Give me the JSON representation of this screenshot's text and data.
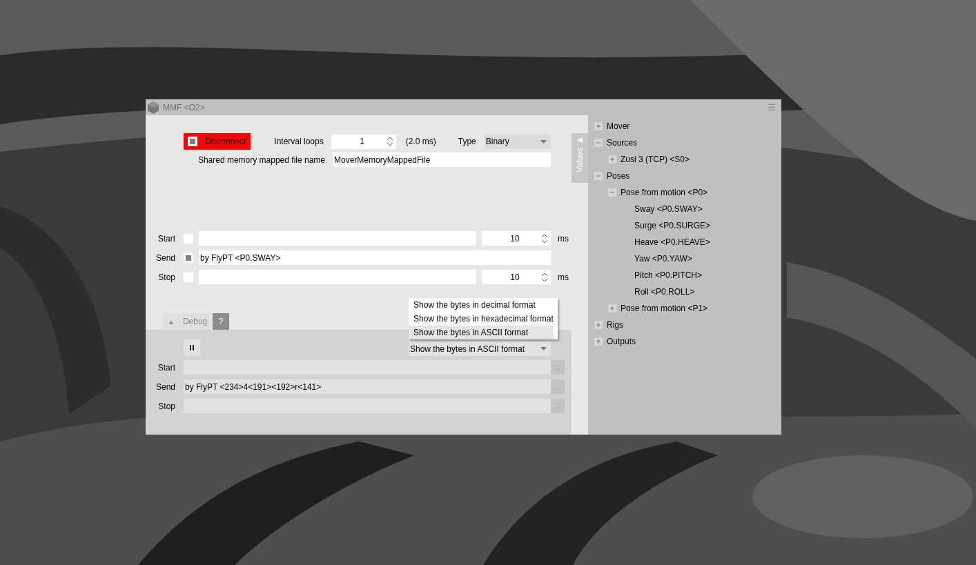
{
  "window": {
    "title": "MMF <O2>",
    "menu": "☰"
  },
  "connection": {
    "button_label": "Disconnect",
    "connected": true
  },
  "interval": {
    "label": "Interval loops",
    "value": "1",
    "note": "(2.0 ms)"
  },
  "type": {
    "label": "Type",
    "value": "Binary"
  },
  "mmf": {
    "label": "Shared memory mapped file name",
    "value": "MoverMemoryMappedFile"
  },
  "values_tab": {
    "label": "Values",
    "arrow": "◀"
  },
  "commands": [
    {
      "label": "Start",
      "checked": false,
      "delay": "10",
      "unit": "ms"
    },
    {
      "label": "Send",
      "checked": true,
      "value": "by FlyPT <P0.SWAY>"
    },
    {
      "label": "Stop",
      "checked": false,
      "delay": "10",
      "unit": "ms"
    }
  ],
  "debug": {
    "arrow": "▲",
    "tab_label": "Debug",
    "help_label": "?",
    "format_value": "Show the bytes in ASCII format",
    "format_menu": [
      {
        "label": "Show the bytes in decimal format",
        "selected": false
      },
      {
        "label": "Show the bytes in hexadecimal format",
        "selected": false
      },
      {
        "label": "Show the bytes in ASCII format",
        "selected": true
      }
    ],
    "rows": [
      {
        "label": "Start",
        "button": "..."
      },
      {
        "label": "Send",
        "value": "by FlyPT <234>4<191><192>r<141>",
        "button": "..."
      },
      {
        "label": "Stop",
        "button": "..."
      }
    ]
  },
  "tree": [
    {
      "label": "Mover",
      "expanded": false
    },
    {
      "label": "Sources",
      "expanded": true,
      "children": [
        {
          "label": "Zusi 3 (TCP) <S0>",
          "expanded": false
        }
      ]
    },
    {
      "label": "Poses",
      "expanded": true,
      "children": [
        {
          "label": "Pose from motion <P0>",
          "expanded": true,
          "children": [
            {
              "label": "Sway <P0.SWAY>"
            },
            {
              "label": "Surge <P0.SURGE>"
            },
            {
              "label": "Heave <P0.HEAVE>"
            },
            {
              "label": "Yaw <P0.YAW>"
            },
            {
              "label": "Pitch <P0.PITCH>"
            },
            {
              "label": "Roll <P0.ROLL>"
            }
          ]
        },
        {
          "label": "Pose from motion <P1>",
          "expanded": false
        }
      ]
    },
    {
      "label": "Rigs",
      "expanded": false
    },
    {
      "label": "Outputs",
      "expanded": false
    }
  ]
}
